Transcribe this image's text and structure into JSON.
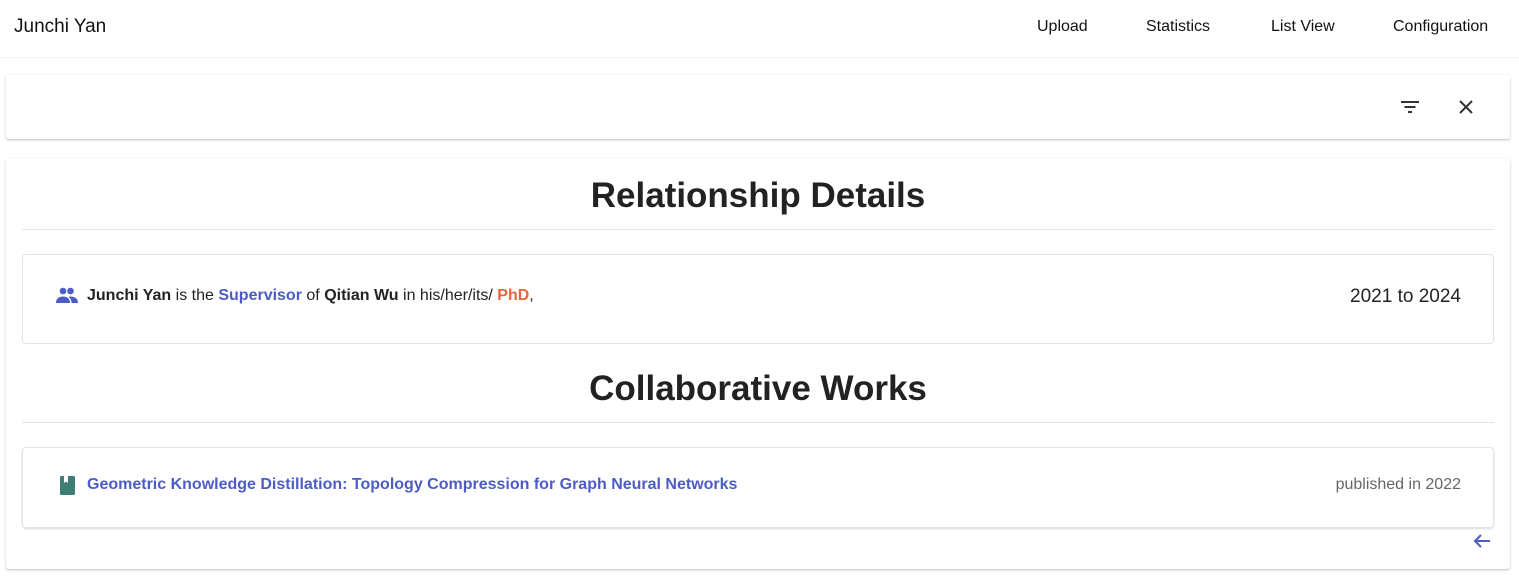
{
  "header": {
    "brand": "Junchi Yan",
    "nav": [
      {
        "label": "Upload"
      },
      {
        "label": "Statistics"
      },
      {
        "label": "List View"
      },
      {
        "label": "Configuration"
      }
    ]
  },
  "toolbar": {
    "filter_icon": "filter-list-icon",
    "close_icon": "close-icon"
  },
  "relationship": {
    "section_title": "Relationship Details",
    "icon": "people-icon",
    "subject": "Junchi Yan",
    "is_the": "is the",
    "role": "Supervisor",
    "of": "of",
    "object": "Qitian Wu",
    "in": "in his/her/its/",
    "degree": "PhD",
    "trailing": ",",
    "years": "2021 to 2024"
  },
  "works": {
    "section_title": "Collaborative Works",
    "items": [
      {
        "icon": "book-icon",
        "title": "Geometric Knowledge Distillation: Topology Compression for Graph Neural Networks",
        "published": "published in 2022"
      }
    ]
  },
  "footer": {
    "back_icon": "arrow-back-icon"
  },
  "colors": {
    "link": "#4c5cc4",
    "degree": "#e8653a",
    "book_icon": "#3d7d74"
  }
}
